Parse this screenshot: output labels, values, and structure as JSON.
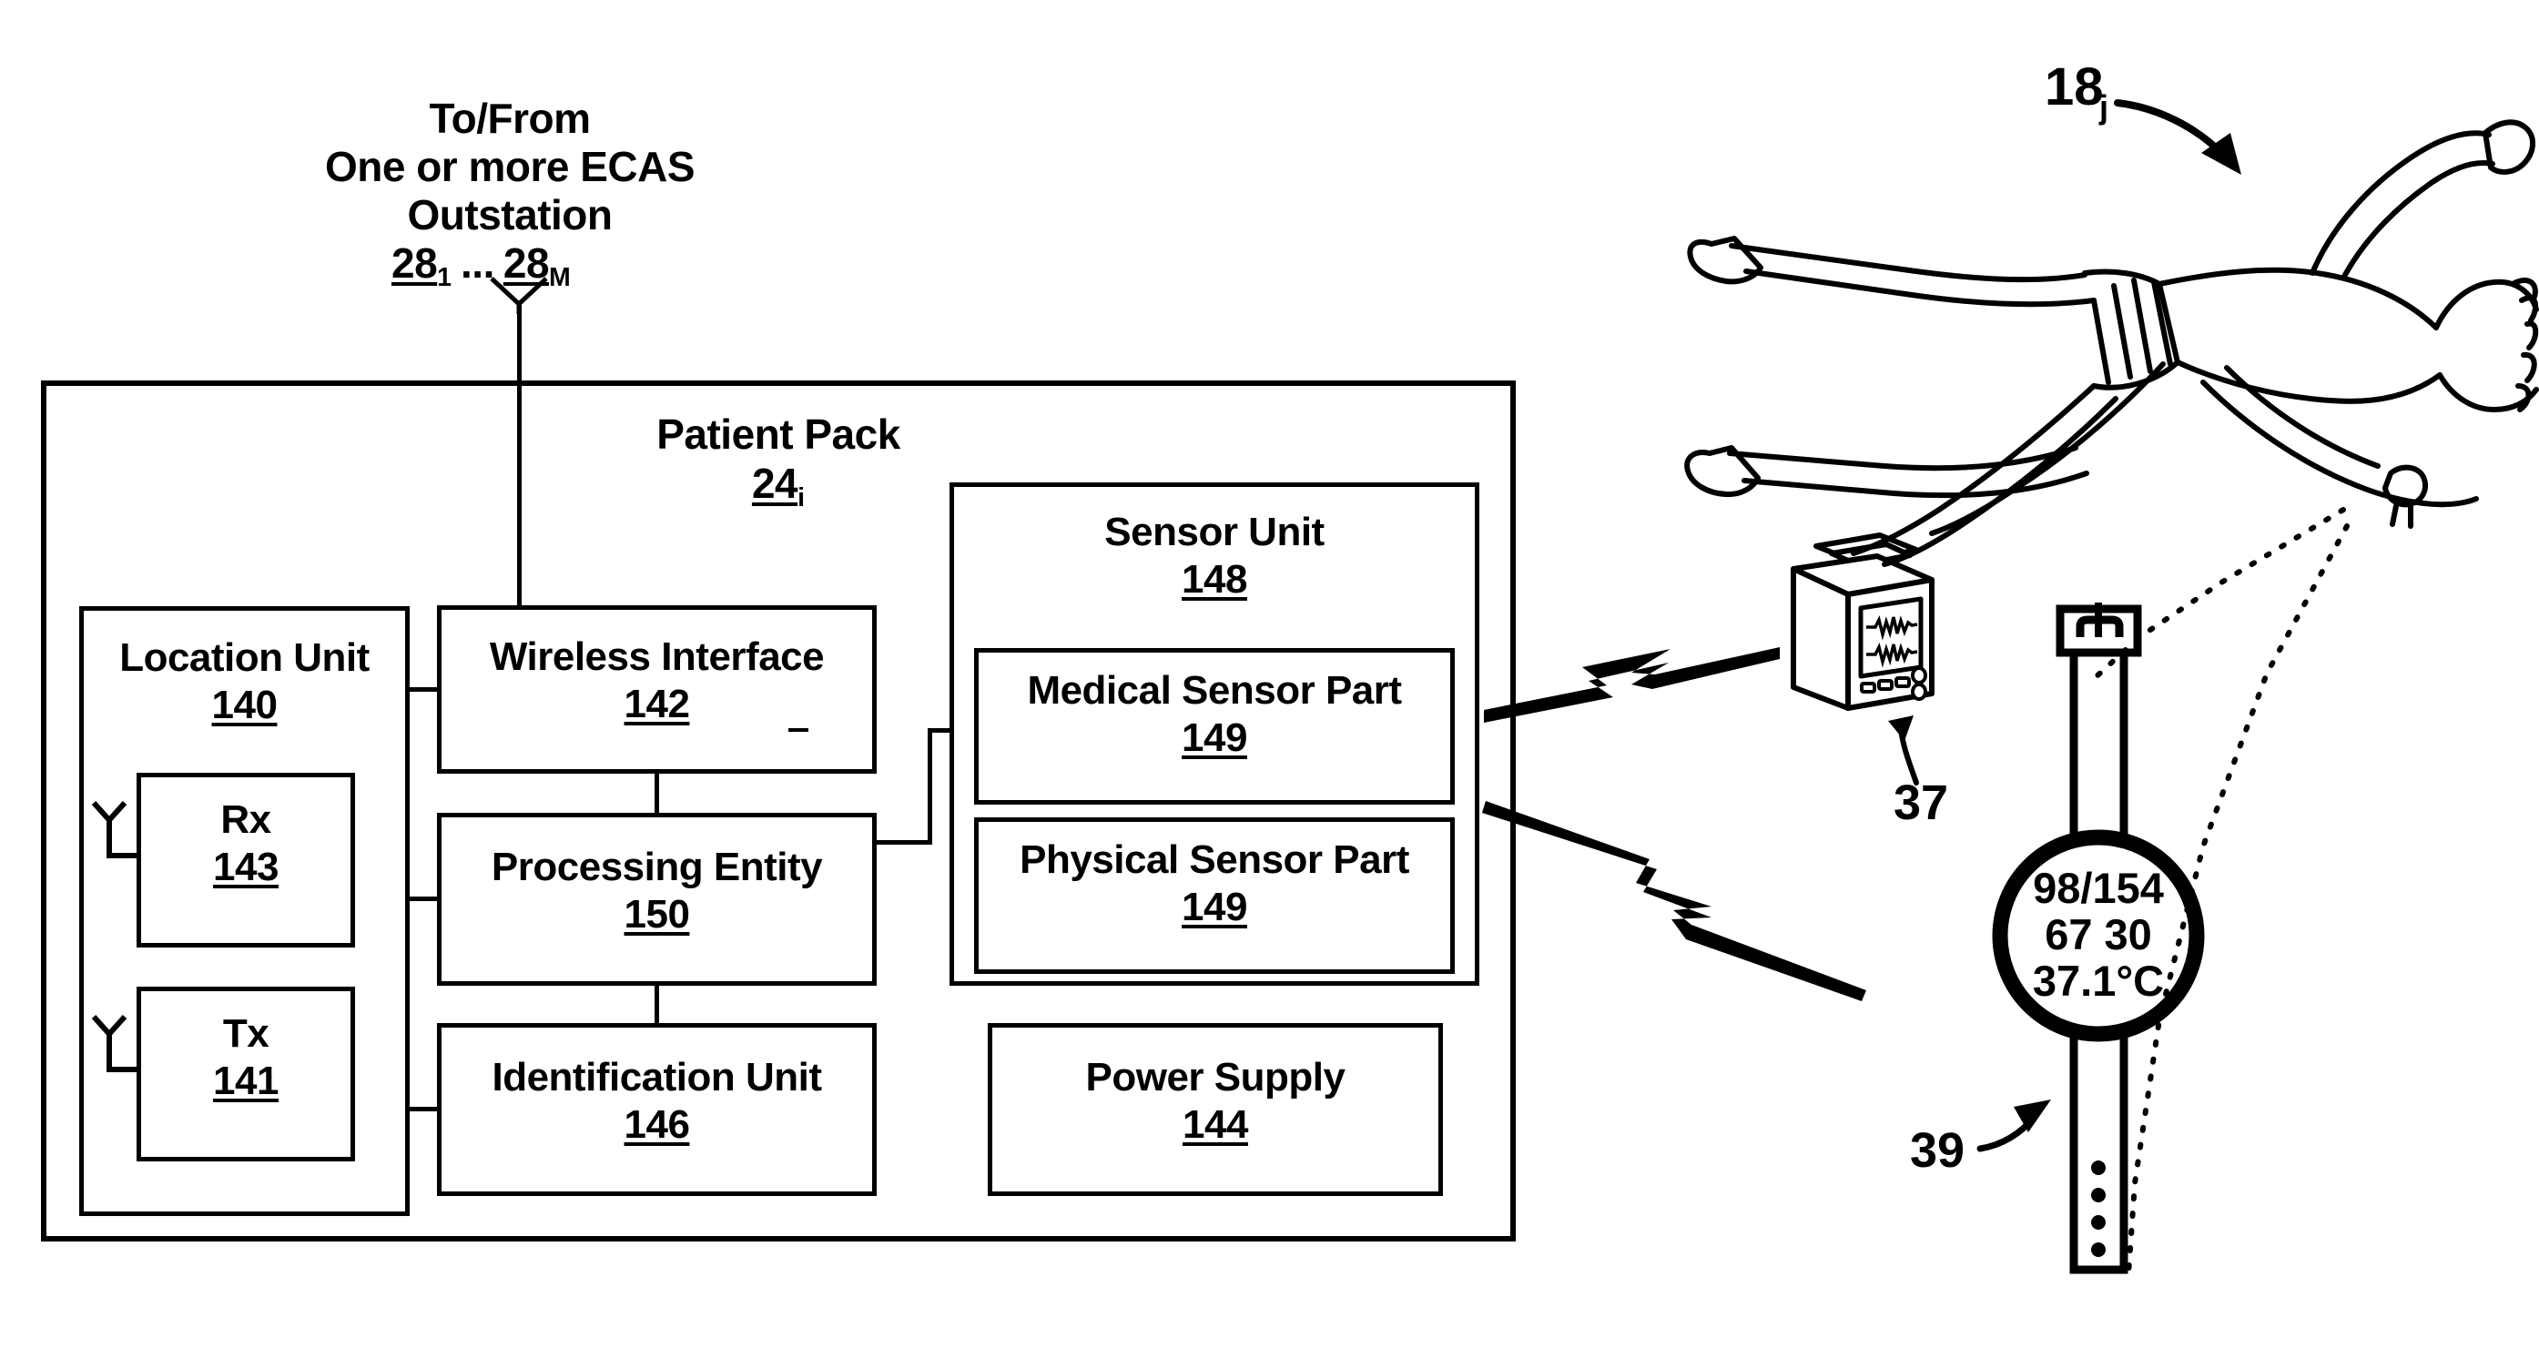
{
  "figure": {
    "header": {
      "line1": "To/From",
      "line2": "One or more ECAS",
      "line3": "Outstation",
      "ref_a_num": "28",
      "ref_a_sub": "1",
      "ref_ellipsis": "...",
      "ref_b_num": "28",
      "ref_b_sub": "M"
    },
    "patient_pack": {
      "title": "Patient Pack",
      "ref_num": "24",
      "ref_sub": "i"
    },
    "blocks": [
      {
        "id": "location-unit",
        "label": "Location Unit",
        "ref": "140"
      },
      {
        "id": "rx",
        "label": "Rx",
        "ref": "143"
      },
      {
        "id": "tx",
        "label": "Tx",
        "ref": "141"
      },
      {
        "id": "wireless-interface",
        "label": "Wireless Interface",
        "ref": "142"
      },
      {
        "id": "processing-entity",
        "label": "Processing Entity",
        "ref": "150"
      },
      {
        "id": "identification-unit",
        "label": "Identification Unit",
        "ref": "146"
      },
      {
        "id": "sensor-unit",
        "label": "Sensor Unit",
        "ref": "148"
      },
      {
        "id": "medical-sensor-part",
        "label": "Medical Sensor Part",
        "ref": "149"
      },
      {
        "id": "physical-sensor-part",
        "label": "Physical Sensor Part",
        "ref": "149"
      },
      {
        "id": "power-supply",
        "label": "Power Supply",
        "ref": "144"
      }
    ],
    "callouts": {
      "patient_num": "18",
      "patient_sub": "j",
      "monitor_ref": "37",
      "watch_ref": "39"
    },
    "watch_display": {
      "line1": "98/154",
      "line2": "67 30",
      "line3": "37.1°C"
    },
    "icons": {
      "antenna_rx": "antenna-icon",
      "antenna_tx": "antenna-icon",
      "ecg_monitor": "patient-monitor-icon",
      "wrist_watch": "wrist-watch-icon",
      "patient": "lying-patient-icon",
      "bolt_upper": "lightning-bolt-icon",
      "bolt_lower": "lightning-bolt-icon"
    },
    "colors": {
      "ink": "#000000",
      "paper": "#ffffff"
    }
  }
}
